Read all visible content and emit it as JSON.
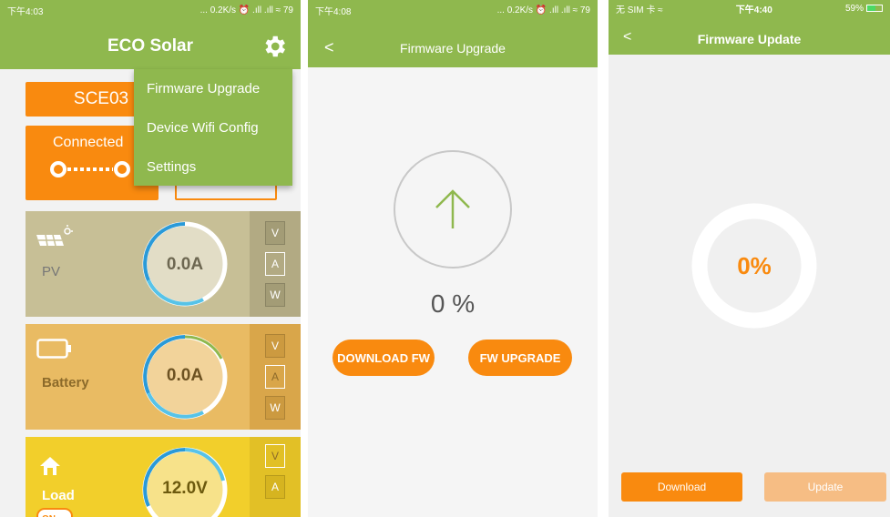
{
  "screen1": {
    "status_time": "下午4:03",
    "status_right": "... 0.2K/s ⏰ .ıll .ıll ≈ 79",
    "title": "ECO Solar",
    "device_name": "SCE03",
    "connection_label": "Connected",
    "menu": [
      "Firmware Upgrade",
      "Device Wifi Config",
      "Settings"
    ],
    "cards": [
      {
        "label": "PV",
        "value": "0.0A",
        "modes": [
          "V",
          "A",
          "W"
        ],
        "color": "#c7bf96"
      },
      {
        "label": "Battery",
        "value": "0.0A",
        "modes": [
          "V",
          "A",
          "W"
        ],
        "color": "#e9bb63"
      },
      {
        "label": "Load",
        "value": "12.0V",
        "modes": [
          "V",
          "A"
        ],
        "color": "#f2cf2b",
        "switch": "ON"
      }
    ]
  },
  "screen2": {
    "status_time": "下午4:08",
    "status_right": "... 0.2K/s ⏰ .ıll .ıll ≈ 79",
    "back": "<",
    "title": "Firmware Upgrade",
    "progress_text": "0 %",
    "progress": 0,
    "download_button": "DOWNLOAD FW",
    "upgrade_button": "FW UPGRADE"
  },
  "screen3": {
    "status_left": "无 SIM 卡 ≈",
    "status_time": "下午4:40",
    "status_right": "59%",
    "back": "<",
    "title": "Firmware Update",
    "progress_text": "0%",
    "progress": 0,
    "download_button": "Download",
    "update_button": "Update"
  },
  "colors": {
    "accent_green": "#8fb84e",
    "orange": "#f98a0f",
    "orange_disabled": "#f6bd84"
  }
}
